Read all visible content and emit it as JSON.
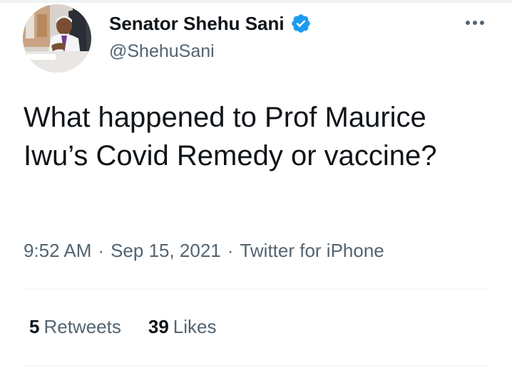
{
  "tweet": {
    "author": {
      "display_name": "Senator Shehu Sani",
      "handle": "@ShehuSani",
      "verified_icon": "verified-badge-icon",
      "avatar_icon": "profile-photo"
    },
    "more_icon": "more-horizontal-icon",
    "text": "What happened to Prof Maurice Iwu’s Covid Remedy or vaccine?",
    "time": "9:52 AM",
    "separator": "·",
    "date": "Sep 15, 2021",
    "source": "Twitter for iPhone",
    "stats": {
      "retweets_count": "5",
      "retweets_label": "Retweets",
      "likes_count": "39",
      "likes_label": "Likes"
    }
  },
  "colors": {
    "text_primary": "#0f1419",
    "text_secondary": "#536471",
    "verified_blue": "#1d9bf0",
    "divider": "#eff3f4"
  }
}
